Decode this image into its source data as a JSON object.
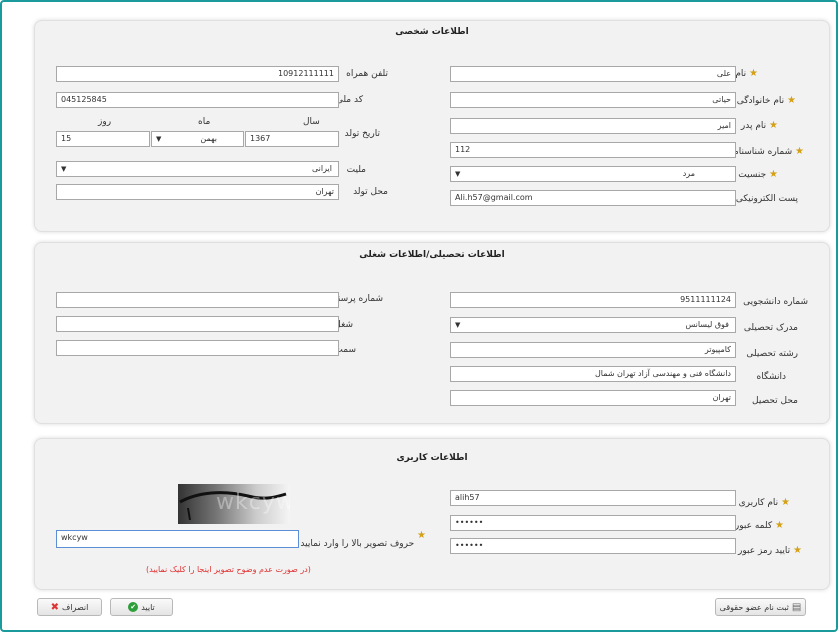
{
  "personal": {
    "title": "اطلاعات شخصی",
    "first_name_label": "نام",
    "first_name": "علی",
    "last_name_label": "نام خانوادگی",
    "last_name": "حیاتی",
    "father_name_label": "نام پدر",
    "father_name": "امیر",
    "id_number_label": "شماره شناسنامه",
    "id_number": "112",
    "gender_label": "جنسیت",
    "gender": "مرد",
    "email_label": "پست الکترونیکی",
    "email": "Ali.h57@gmail.com",
    "mobile_label": "تلفن همراه",
    "mobile": "10912111111",
    "national_code_label": "کد ملی",
    "national_code": "045125845",
    "birth_date_label": "تاریخ تولد",
    "year_label": "سال",
    "month_label": "ماه",
    "day_label": "روز",
    "year": "1367",
    "month": "بهمن",
    "day": "15",
    "nationality_label": "ملیت",
    "nationality": "ایرانی",
    "birth_place_label": "محل تولد",
    "birth_place": "تهران"
  },
  "education": {
    "title": "اطلاعات تحصیلی/اطلاعات شغلی",
    "student_no_label": "شماره دانشجویی",
    "student_no": "9511111124",
    "degree_label": "مدرک تحصیلی",
    "degree": "فوق لیسانس",
    "field_label": "رشته تحصیلی",
    "field": "کامپیوتر",
    "university_label": "دانشگاه",
    "university": "دانشگاه فنی و مهندسی آزاد تهران شمال",
    "study_place_label": "محل تحصیل",
    "study_place": "تهران",
    "personnel_no_label": "شماره پرسنلی",
    "job_label": "شغل",
    "position_label": "سمت"
  },
  "user": {
    "title": "اطلاعات کاربری",
    "username_label": "نام کاربری",
    "username": "alih57",
    "password_label": "کلمه عبور",
    "password": "••••••",
    "confirm_label": "تایید رمز عبور",
    "confirm": "••••••",
    "captcha_label": "حروف تصویر بالا را وارد نمایید",
    "captcha_value": "wkcyw",
    "captcha_image_text": "wkcyw",
    "captcha_hint": "(در صورت عدم وضوح تصویر اینجا را کلیک نمایید)"
  },
  "footer": {
    "cancel_label": "انصراف",
    "confirm_label": "تایید",
    "register_legal_label": "ثبت نام عضو حقوقی"
  },
  "colors": {
    "frame": "#1a9a9a",
    "star": "#d4a017",
    "hint": "#e03030"
  }
}
